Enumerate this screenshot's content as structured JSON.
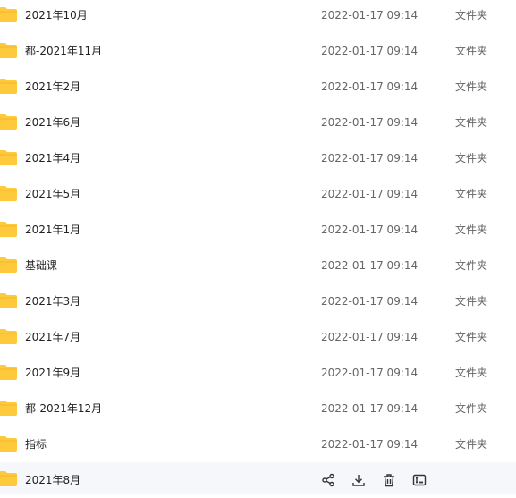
{
  "files": [
    {
      "name": "2021年10月",
      "date": "2022-01-17 09:14",
      "type": "文件夹"
    },
    {
      "name": "都-2021年11月",
      "date": "2022-01-17 09:14",
      "type": "文件夹"
    },
    {
      "name": "2021年2月",
      "date": "2022-01-17 09:14",
      "type": "文件夹"
    },
    {
      "name": "2021年6月",
      "date": "2022-01-17 09:14",
      "type": "文件夹"
    },
    {
      "name": "2021年4月",
      "date": "2022-01-17 09:14",
      "type": "文件夹"
    },
    {
      "name": "2021年5月",
      "date": "2022-01-17 09:14",
      "type": "文件夹"
    },
    {
      "name": "2021年1月",
      "date": "2022-01-17 09:14",
      "type": "文件夹"
    },
    {
      "name": "基础课",
      "date": "2022-01-17 09:14",
      "type": "文件夹"
    },
    {
      "name": "2021年3月",
      "date": "2022-01-17 09:14",
      "type": "文件夹"
    },
    {
      "name": "2021年7月",
      "date": "2022-01-17 09:14",
      "type": "文件夹"
    },
    {
      "name": "2021年9月",
      "date": "2022-01-17 09:14",
      "type": "文件夹"
    },
    {
      "name": "都-2021年12月",
      "date": "2022-01-17 09:14",
      "type": "文件夹"
    },
    {
      "name": "指标",
      "date": "2022-01-17 09:14",
      "type": "文件夹"
    },
    {
      "name": "2021年8月"
    }
  ],
  "colors": {
    "folder": "#ffc93c",
    "folder_tab": "#f5b82e",
    "icon": "#333333"
  },
  "hover_actions": [
    "share-icon",
    "download-icon",
    "delete-icon",
    "rename-icon"
  ]
}
